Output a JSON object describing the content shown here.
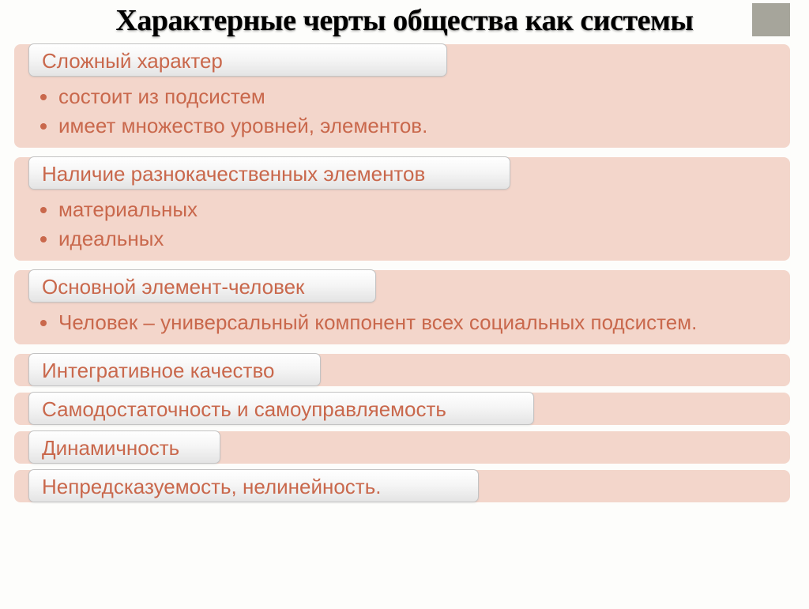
{
  "title": "Характерные черты общества как системы",
  "sections": [
    {
      "header": "Сложный характер",
      "bullets": [
        "состоит из подсистем",
        "имеет множество уровней, элементов."
      ]
    },
    {
      "header": "Наличие разнокачественных элементов",
      "bullets": [
        "материальных",
        "идеальных"
      ]
    },
    {
      "header": "Основной элемент-человек",
      "bullets": [
        "Человек – универсальный компонент всех социальных подсистем."
      ]
    },
    {
      "header": "Интегративное качество",
      "bullets": []
    },
    {
      "header": "Самодостаточность и самоуправляемость",
      "bullets": []
    },
    {
      "header": "Динамичность",
      "bullets": []
    },
    {
      "header": "Непредсказуемость, нелинейность.",
      "bullets": []
    }
  ]
}
